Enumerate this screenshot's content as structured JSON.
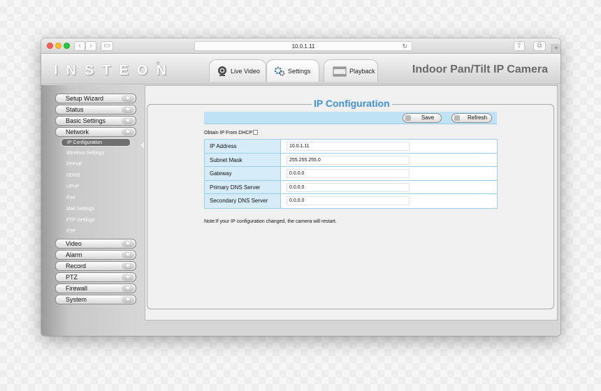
{
  "browser": {
    "url": "10.0.1.11"
  },
  "header": {
    "logo": "INSTEON",
    "logo_mark": "®",
    "tabs": [
      {
        "label": "Live Video",
        "icon": "webcam-icon"
      },
      {
        "label": "Settings",
        "icon": "gears-icon"
      },
      {
        "label": "Playback",
        "icon": "film-icon"
      }
    ],
    "product_title": "Indoor Pan/Tilt IP Camera"
  },
  "sidebar": {
    "menu": [
      "Setup Wizard",
      "Status",
      "Basic Settings",
      "Network"
    ],
    "network_items": [
      "IP Configuration",
      "Wireless Settings",
      "PPPoE",
      "DDNS",
      "UPnP",
      "Port",
      "Mail Settings",
      "FTP Settings",
      "P2P"
    ],
    "menu_after": [
      "Video",
      "Alarm",
      "Record",
      "PTZ",
      "Firewall",
      "System"
    ],
    "active_item": "IP Configuration"
  },
  "main": {
    "section_title": "IP Configuration",
    "save_label": "Save",
    "refresh_label": "Refresh",
    "dhcp_label": "Obtain IP From DHCP",
    "dhcp_checked": false,
    "fields": [
      {
        "label": "IP Address",
        "value": "10.0.1.11"
      },
      {
        "label": "Subnet Mask",
        "value": "255.255.255.0"
      },
      {
        "label": "Gateway",
        "value": "0.0.0.0"
      },
      {
        "label": "Primary DNS Server",
        "value": "0.0.0.0"
      },
      {
        "label": "Secondary DNS Server",
        "value": "0.0.0.0"
      }
    ],
    "note": "Note:If your IP configuration changed, the camera will restart."
  },
  "colors": {
    "accent": "#3f8fd8",
    "table_header_bg": "#d6ecf8",
    "toolbar_bg": "#bfe2f4"
  }
}
